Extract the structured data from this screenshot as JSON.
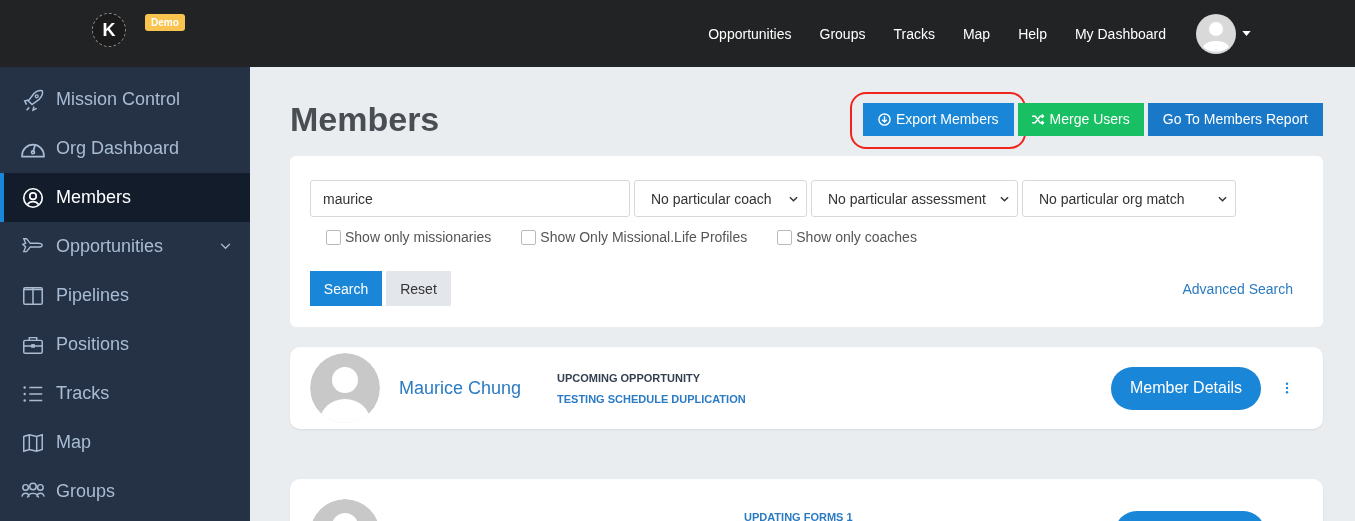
{
  "topbar": {
    "logo": "K",
    "badge": "Demo",
    "nav": [
      "Opportunities",
      "Groups",
      "Tracks",
      "Map",
      "Help",
      "My Dashboard"
    ]
  },
  "sidebar": {
    "items": [
      {
        "label": "Mission Control",
        "selected": false
      },
      {
        "label": "Org Dashboard",
        "selected": false
      },
      {
        "label": "Members",
        "selected": true
      },
      {
        "label": "Opportunities",
        "selected": false,
        "expanded": false
      },
      {
        "label": "Pipelines",
        "selected": false
      },
      {
        "label": "Positions",
        "selected": false
      },
      {
        "label": "Tracks",
        "selected": false
      },
      {
        "label": "Map",
        "selected": false
      },
      {
        "label": "Groups",
        "selected": false
      }
    ]
  },
  "page": {
    "title": "Members",
    "actions": [
      {
        "label": "Export Members",
        "kind": "export",
        "highlighted": true
      },
      {
        "label": "Merge Users",
        "kind": "merge",
        "highlighted": false
      },
      {
        "label": "Go To Members Report",
        "kind": "report",
        "highlighted": false
      }
    ]
  },
  "filters": {
    "search": {
      "value": "maurice"
    },
    "selects": [
      "No particular coach",
      "No particular assessment",
      "No particular org match"
    ],
    "checkboxes": [
      {
        "label": "Show only missionaries",
        "checked": false
      },
      {
        "label": "Show Only Missional.Life Profiles",
        "checked": false
      },
      {
        "label": "Show only coaches",
        "checked": false
      }
    ],
    "search_button": "Search",
    "reset_button": "Reset",
    "advanced_link": "Advanced Search"
  },
  "members": [
    {
      "name": "Maurice Chung",
      "heading": "UPCOMING OPPORTUNITY",
      "opportunity": "TESTING SCHEDULE DUPLICATION",
      "button": "Member Details"
    },
    {
      "opportunity": "UPDATING FORMS 1"
    }
  ]
}
